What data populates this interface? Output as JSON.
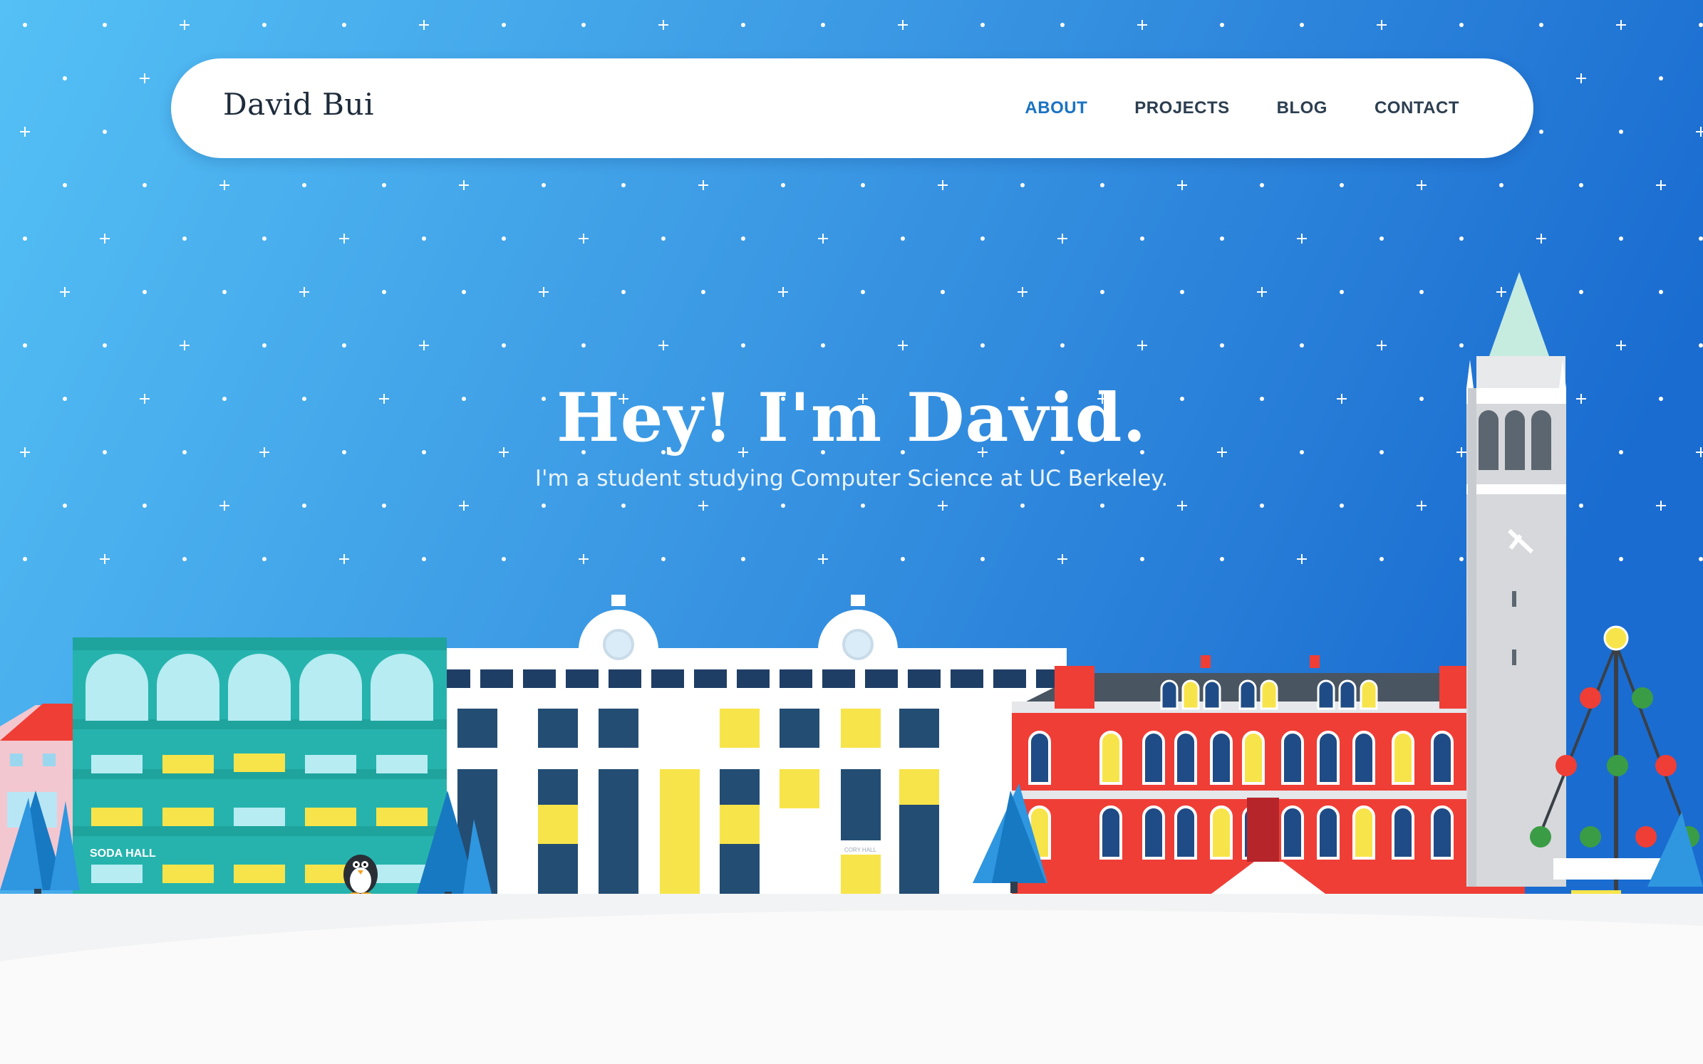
{
  "nav": {
    "brand": "David Bui",
    "items": [
      {
        "label": "ABOUT",
        "active": true
      },
      {
        "label": "PROJECTS",
        "active": false
      },
      {
        "label": "BLOG",
        "active": false
      },
      {
        "label": "CONTACT",
        "active": false
      }
    ]
  },
  "hero": {
    "title": "Hey! I'm David.",
    "subtitle": "I'm a student studying Computer Science at UC Berkeley."
  },
  "scene": {
    "soda_label": "SODA HALL",
    "cory_label": "CORY HALL"
  },
  "colors": {
    "sky_left": "#54c0f5",
    "sky_right": "#1a6cd0",
    "nav_active": "#1a73c2",
    "soda_hall": "#26b3ad",
    "red_hall": "#ef3e36",
    "snow": "#fafafa"
  }
}
